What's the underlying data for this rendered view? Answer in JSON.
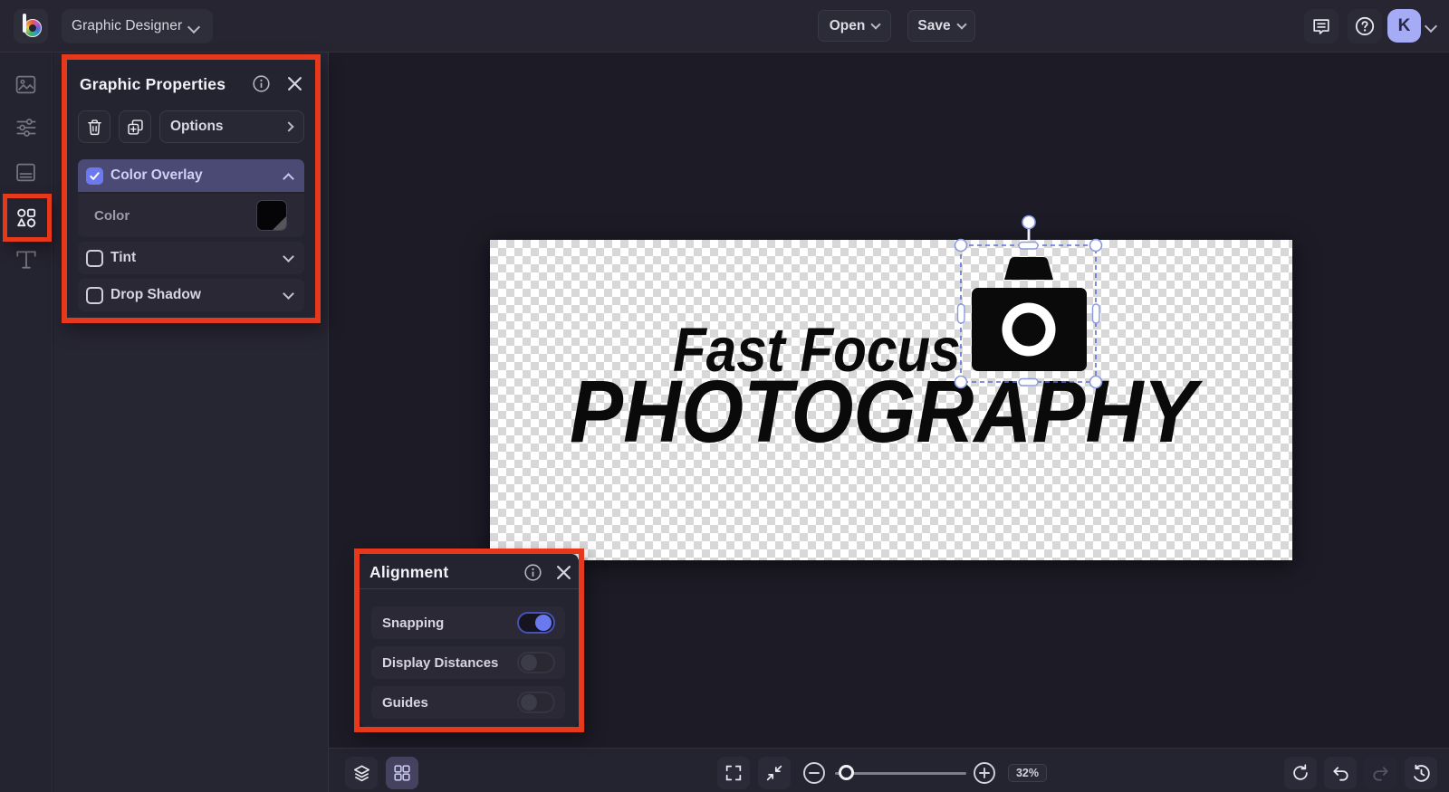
{
  "topbar": {
    "product_label": "Graphic Designer",
    "open_label": "Open",
    "save_label": "Save",
    "avatar_initial": "K"
  },
  "sidebar": {
    "items": [
      {
        "name": "images"
      },
      {
        "name": "edit"
      },
      {
        "name": "templates"
      },
      {
        "name": "graphics",
        "active": true,
        "annotated": true
      },
      {
        "name": "text"
      }
    ]
  },
  "graphic_properties_panel": {
    "title": "Graphic Properties",
    "options_label": "Options",
    "color_overlay": {
      "label": "Color Overlay",
      "checked": true
    },
    "color_row": {
      "label": "Color",
      "value": "#000000"
    },
    "tint": {
      "label": "Tint",
      "checked": false
    },
    "drop_shadow": {
      "label": "Drop Shadow",
      "checked": false
    }
  },
  "alignment_panel": {
    "title": "Alignment",
    "snapping": {
      "label": "Snapping",
      "on": true
    },
    "display_distances": {
      "label": "Display Distances",
      "on": false
    },
    "guides": {
      "label": "Guides",
      "on": false
    }
  },
  "canvas": {
    "logo_line1": "Fast Focus",
    "logo_line2": "PHOTOGRAPHY",
    "selected_object": "camera-graphic"
  },
  "bottombar": {
    "zoom_value": "32%"
  },
  "colors": {
    "annotation_red": "#e6391c",
    "accent_periwinkle": "#6b79ee",
    "checkbox_blue": "#6c79f1",
    "overlay_row_indigo": "#4b4a74",
    "avatar_bg": "#a6abf5",
    "panel_bg": "#242330",
    "canvas_bg": "#1c1b26",
    "swatch_color": "#000000"
  }
}
